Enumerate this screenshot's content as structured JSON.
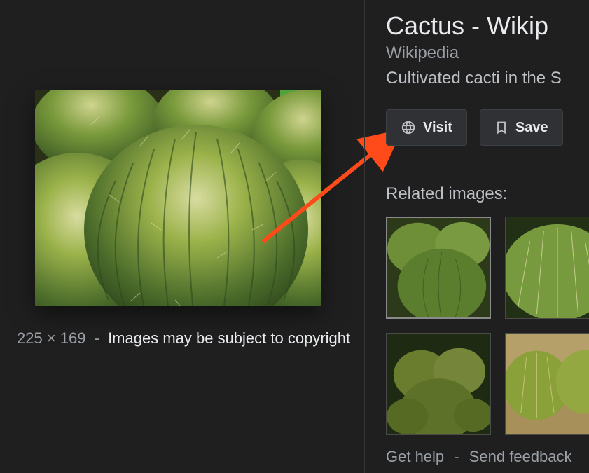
{
  "main": {
    "dimensions": "225 × 169",
    "separator": "-",
    "copyright_notice": "Images may be subject to copyright"
  },
  "detail": {
    "title": "Cactus - Wikip",
    "source": "Wikipedia",
    "description": "Cultivated cacti in the S",
    "buttons": {
      "visit": "Visit",
      "save": "Save"
    },
    "related_heading": "Related images:"
  },
  "footer": {
    "help": "Get help",
    "separator": "-",
    "feedback": "Send feedback"
  }
}
